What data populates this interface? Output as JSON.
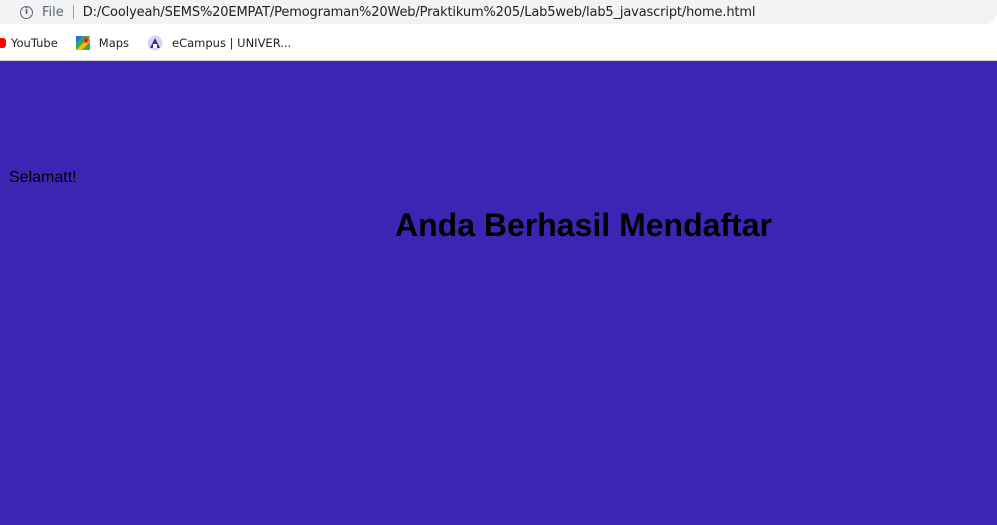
{
  "browser": {
    "scheme_label": "File",
    "url": "D:/Coolyeah/SEMS%20EMPAT/Pemograman%20Web/Praktikum%205/Lab5web/lab5_javascript/home.html",
    "bookmarks": [
      {
        "label": "YouTube",
        "icon": "youtube-icon"
      },
      {
        "label": "Maps",
        "icon": "maps-icon"
      },
      {
        "label": "eCampus | UNIVER...",
        "icon": "campus-icon"
      }
    ]
  },
  "page": {
    "background_color": "#3b26b4",
    "greeting": "Selamatt!",
    "heading": "Anda Berhasil Mendaftar"
  }
}
